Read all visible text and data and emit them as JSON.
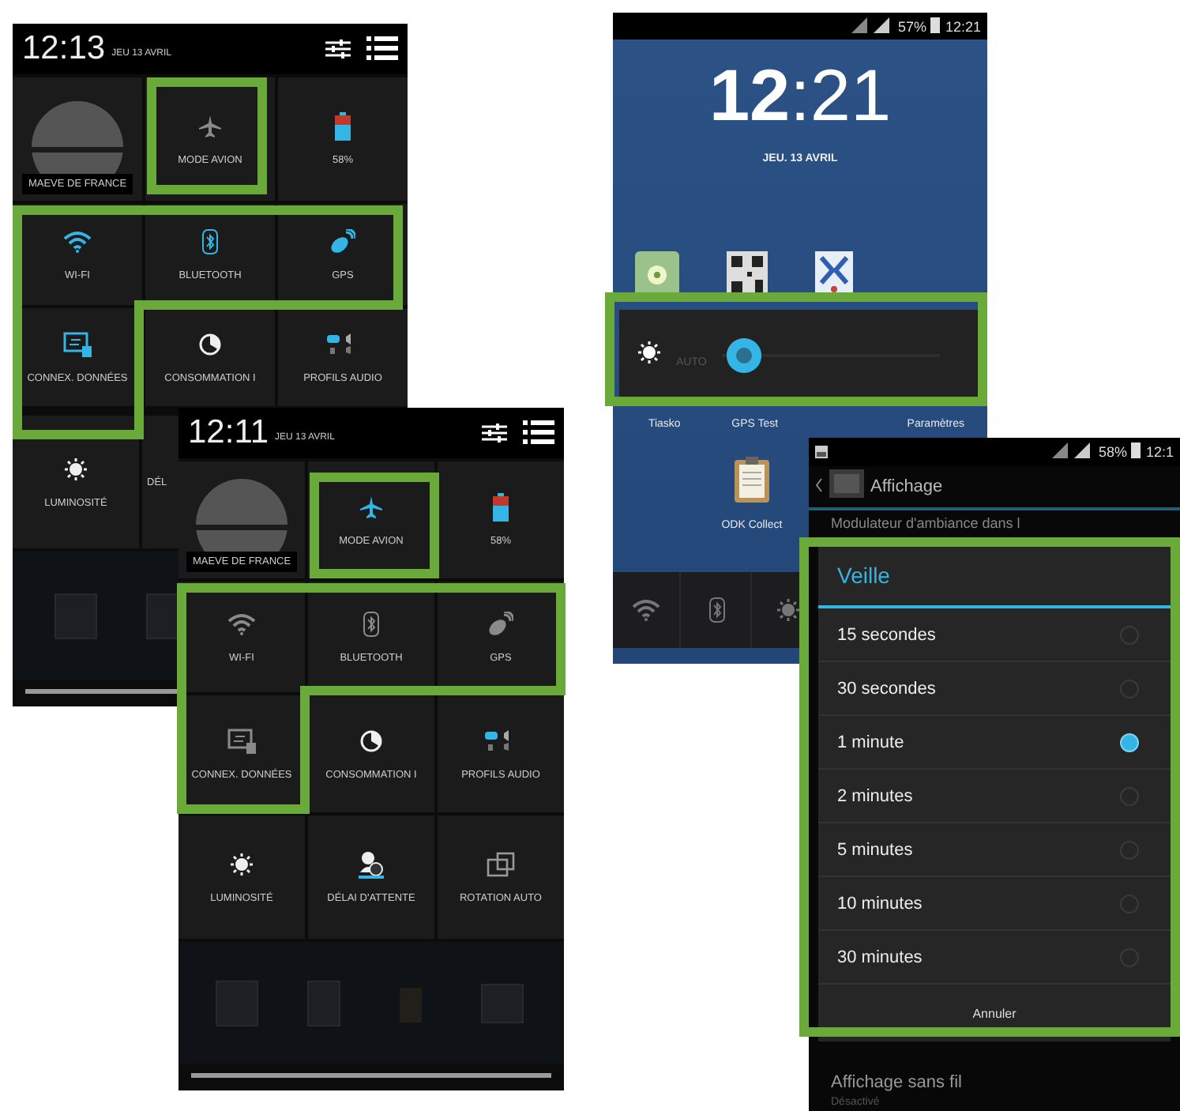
{
  "panels": [
    {
      "kind": "quick_settings",
      "time": "12:13",
      "date": "JEU 13 AVRIL",
      "tile_rows": [
        [
          {
            "kind": "profile",
            "label": "MAEVE DE FRANCE",
            "active": false
          },
          {
            "kind": "airplane",
            "label": "MODE AVION",
            "active": false
          },
          {
            "kind": "battery",
            "label": "58%",
            "active": true
          }
        ],
        [
          {
            "kind": "wifi",
            "label": "WI-FI",
            "active": true
          },
          {
            "kind": "bluetooth",
            "label": "BLUETOOTH",
            "active": true
          },
          {
            "kind": "gps",
            "label": "GPS",
            "active": true
          }
        ],
        [
          {
            "kind": "data",
            "label": "CONNEX. DONNÉES",
            "active": true
          },
          {
            "kind": "usage",
            "label": "CONSOMMATION I",
            "active": false
          },
          {
            "kind": "audio",
            "label": "PROFILS AUDIO",
            "active": true
          }
        ],
        [
          {
            "kind": "brightness",
            "label": "LUMINOSITÉ",
            "active": false
          },
          {
            "kind": "cut",
            "label": "DÉL",
            "active": false
          }
        ]
      ]
    },
    {
      "kind": "quick_settings",
      "time": "12:11",
      "date": "JEU 13 AVRIL",
      "tile_rows": [
        [
          {
            "kind": "profile",
            "label": "MAEVE DE FRANCE",
            "active": false
          },
          {
            "kind": "airplane",
            "label": "MODE AVION",
            "active": true
          },
          {
            "kind": "battery",
            "label": "58%",
            "active": true
          }
        ],
        [
          {
            "kind": "wifi",
            "label": "WI-FI",
            "active": false
          },
          {
            "kind": "bluetooth",
            "label": "BLUETOOTH",
            "active": false
          },
          {
            "kind": "gps",
            "label": "GPS",
            "active": false
          }
        ],
        [
          {
            "kind": "data",
            "label": "CONNEX. DONNÉES",
            "active": false
          },
          {
            "kind": "usage",
            "label": "CONSOMMATION I",
            "active": false
          },
          {
            "kind": "audio",
            "label": "PROFILS AUDIO",
            "active": true
          }
        ],
        [
          {
            "kind": "brightness",
            "label": "LUMINOSITÉ",
            "active": false
          },
          {
            "kind": "timeout",
            "label": "DÉLAI D'ATTENTE",
            "active": false
          },
          {
            "kind": "rotation",
            "label": "ROTATION AUTO",
            "active": false
          }
        ]
      ]
    },
    {
      "kind": "home",
      "battery": "57%",
      "time": "12:21",
      "clock": "**12**:21",
      "date": "JEU. 13 AVRIL",
      "brightness": {
        "label": "AUTO",
        "level": 0.1
      },
      "app_labels": [
        "Tiasko",
        "GPS Test",
        "Paramètres"
      ],
      "app": "ODK Collect"
    },
    {
      "kind": "settings_dialog",
      "battery": "58%",
      "time": "12:1",
      "title": "Affichage",
      "peek": "Modulateur d'ambiance dans l",
      "dialog": {
        "title": "Veille",
        "options": [
          {
            "label": "15 secondes",
            "selected": false
          },
          {
            "label": "30 secondes",
            "selected": false
          },
          {
            "label": "1 minute",
            "selected": true
          },
          {
            "label": "2 minutes",
            "selected": false
          },
          {
            "label": "5 minutes",
            "selected": false
          },
          {
            "label": "10 minutes",
            "selected": false
          },
          {
            "label": "30 minutes",
            "selected": false
          }
        ],
        "button": "Annuler"
      },
      "setting": {
        "title": "Affichage sans fil",
        "subtitle": "Désactivé"
      }
    }
  ]
}
